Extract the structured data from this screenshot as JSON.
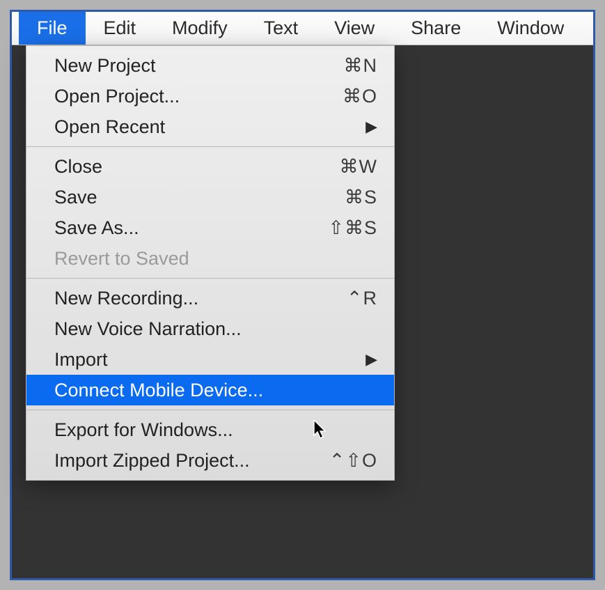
{
  "menubar": {
    "items": [
      {
        "label": "File",
        "active": true
      },
      {
        "label": "Edit",
        "active": false
      },
      {
        "label": "Modify",
        "active": false
      },
      {
        "label": "Text",
        "active": false
      },
      {
        "label": "View",
        "active": false
      },
      {
        "label": "Share",
        "active": false
      },
      {
        "label": "Window",
        "active": false
      }
    ]
  },
  "file_menu": {
    "groups": [
      [
        {
          "label": "New Project",
          "shortcut": "⌘N"
        },
        {
          "label": "Open Project...",
          "shortcut": "⌘O"
        },
        {
          "label": "Open Recent",
          "submenu": true
        }
      ],
      [
        {
          "label": "Close",
          "shortcut": "⌘W"
        },
        {
          "label": "Save",
          "shortcut": "⌘S"
        },
        {
          "label": "Save As...",
          "shortcut": "⇧⌘S"
        },
        {
          "label": "Revert to Saved",
          "disabled": true
        }
      ],
      [
        {
          "label": "New Recording...",
          "shortcut": "⌃R"
        },
        {
          "label": "New Voice Narration..."
        },
        {
          "label": "Import",
          "submenu": true
        },
        {
          "label": "Connect Mobile Device...",
          "selected": true
        }
      ],
      [
        {
          "label": "Export for Windows..."
        },
        {
          "label": "Import Zipped Project...",
          "shortcut": "⌃⇧O"
        }
      ]
    ]
  }
}
